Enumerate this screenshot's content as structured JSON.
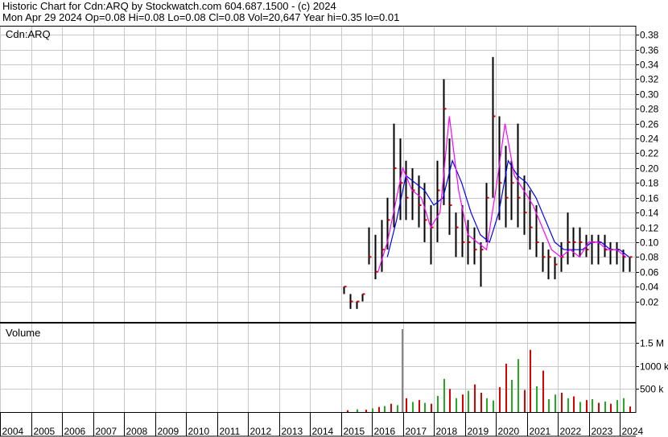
{
  "header": {
    "line1": "Historic Chart for Cdn:ARQ by Stockwatch.com 604.687.1500 - (c) 2024",
    "line2": "Mon Apr 29 2024  Op=0.08  Hi=0.08  Lo=0.08  Cl=0.08  Vol=20,647  Year hi=0.35  lo=0.01"
  },
  "panels": {
    "price_label": "Cdn:ARQ",
    "volume_label": "Volume"
  },
  "colors": {
    "background": "#ffffff",
    "grid": "#c8c8c8",
    "price_bars": "#000000",
    "moving_avg_fast": "#ff00ff",
    "moving_avg_slow": "#0000ff",
    "close_marks": "#cc0000",
    "volume_up": "#22aa22",
    "volume_down": "#dd0000",
    "volume_spike": "#888888"
  },
  "chart_data": [
    {
      "type": "line",
      "panel": "price",
      "title": "Cdn:ARQ",
      "x_ticks": [
        "2004",
        "2005",
        "2006",
        "2007",
        "2008",
        "2009",
        "2010",
        "2011",
        "2012",
        "2013",
        "2014",
        "2015",
        "2016",
        "2017",
        "2018",
        "2019",
        "2020",
        "2021",
        "2022",
        "2023",
        "2024"
      ],
      "y_ticks": [
        "0.38",
        "0.36",
        "0.34",
        "0.32",
        "0.30",
        "0.28",
        "0.26",
        "0.24",
        "0.22",
        "0.20",
        "0.18",
        "0.16",
        "0.14",
        "0.12",
        "0.10",
        "0.08",
        "0.06",
        "0.04",
        "0.02"
      ],
      "ylim": [
        0,
        0.39
      ],
      "grid": true,
      "series": [
        {
          "role": "high_low_close",
          "x": [
            2015.1,
            2015.3,
            2015.5,
            2015.7,
            2015.9,
            2016.1,
            2016.3,
            2016.5,
            2016.7,
            2016.9,
            2017.1,
            2017.3,
            2017.5,
            2017.7,
            2017.9,
            2018.1,
            2018.3,
            2018.5,
            2018.7,
            2018.9,
            2019.1,
            2019.3,
            2019.5,
            2019.7,
            2019.9,
            2020.1,
            2020.3,
            2020.5,
            2020.7,
            2020.9,
            2021.1,
            2021.3,
            2021.5,
            2021.7,
            2021.9,
            2022.1,
            2022.3,
            2022.5,
            2022.7,
            2022.9,
            2023.1,
            2023.3,
            2023.5,
            2023.7,
            2023.9,
            2024.1,
            2024.3
          ],
          "high": [
            0.04,
            0.03,
            0.02,
            0.03,
            0.12,
            0.11,
            0.13,
            0.16,
            0.26,
            0.24,
            0.21,
            0.2,
            0.19,
            0.18,
            0.15,
            0.21,
            0.32,
            0.24,
            0.14,
            0.15,
            0.13,
            0.12,
            0.1,
            0.18,
            0.35,
            0.27,
            0.23,
            0.21,
            0.26,
            0.19,
            0.17,
            0.15,
            0.1,
            0.09,
            0.08,
            0.1,
            0.14,
            0.12,
            0.12,
            0.11,
            0.11,
            0.11,
            0.11,
            0.1,
            0.1,
            0.09,
            0.08
          ],
          "low": [
            0.03,
            0.01,
            0.01,
            0.02,
            0.07,
            0.05,
            0.06,
            0.09,
            0.12,
            0.13,
            0.13,
            0.13,
            0.12,
            0.1,
            0.07,
            0.1,
            0.15,
            0.11,
            0.08,
            0.08,
            0.07,
            0.07,
            0.04,
            0.1,
            0.16,
            0.13,
            0.12,
            0.13,
            0.12,
            0.11,
            0.09,
            0.08,
            0.06,
            0.05,
            0.05,
            0.06,
            0.07,
            0.08,
            0.08,
            0.08,
            0.07,
            0.07,
            0.08,
            0.07,
            0.07,
            0.06,
            0.06
          ],
          "close": [
            0.04,
            0.02,
            0.02,
            0.03,
            0.08,
            0.06,
            0.09,
            0.13,
            0.2,
            0.18,
            0.16,
            0.17,
            0.15,
            0.13,
            0.12,
            0.17,
            0.28,
            0.15,
            0.12,
            0.1,
            0.1,
            0.09,
            0.09,
            0.16,
            0.27,
            0.18,
            0.16,
            0.18,
            0.16,
            0.14,
            0.12,
            0.1,
            0.08,
            0.08,
            0.07,
            0.08,
            0.1,
            0.1,
            0.1,
            0.09,
            0.1,
            0.1,
            0.09,
            0.09,
            0.09,
            0.08,
            0.08
          ]
        },
        {
          "role": "moving_average_fast",
          "x": [
            2016.2,
            2016.5,
            2016.8,
            2017.0,
            2017.3,
            2017.6,
            2017.9,
            2018.2,
            2018.5,
            2018.8,
            2019.1,
            2019.4,
            2019.7,
            2020.0,
            2020.3,
            2020.6,
            2020.9,
            2021.2,
            2021.5,
            2021.8,
            2022.1,
            2022.4,
            2022.7,
            2023.0,
            2023.3,
            2023.6,
            2023.9,
            2024.2
          ],
          "values": [
            0.06,
            0.1,
            0.16,
            0.2,
            0.17,
            0.16,
            0.12,
            0.14,
            0.27,
            0.17,
            0.11,
            0.1,
            0.09,
            0.17,
            0.26,
            0.19,
            0.17,
            0.15,
            0.12,
            0.09,
            0.08,
            0.09,
            0.08,
            0.1,
            0.1,
            0.09,
            0.09,
            0.08
          ]
        },
        {
          "role": "moving_average_slow",
          "x": [
            2016.5,
            2016.8,
            2017.1,
            2017.4,
            2017.7,
            2018.0,
            2018.3,
            2018.6,
            2018.9,
            2019.2,
            2019.5,
            2019.8,
            2020.1,
            2020.4,
            2020.7,
            2021.0,
            2021.3,
            2021.6,
            2021.9,
            2022.2,
            2022.5,
            2022.8,
            2023.1,
            2023.4,
            2023.7,
            2024.0,
            2024.3
          ],
          "values": [
            0.08,
            0.13,
            0.19,
            0.18,
            0.17,
            0.15,
            0.16,
            0.21,
            0.18,
            0.14,
            0.11,
            0.1,
            0.14,
            0.21,
            0.19,
            0.18,
            0.16,
            0.13,
            0.1,
            0.09,
            0.09,
            0.09,
            0.1,
            0.1,
            0.09,
            0.09,
            0.08
          ]
        }
      ]
    },
    {
      "type": "bar",
      "panel": "volume",
      "title": "Volume",
      "y_ticks": [
        "1.5 M",
        "1000 k",
        "500 k"
      ],
      "ylim": [
        0,
        1800000
      ],
      "x": [
        2015.2,
        2015.5,
        2015.8,
        2016.0,
        2016.2,
        2016.4,
        2016.6,
        2016.8,
        2016.95,
        2017.1,
        2017.3,
        2017.5,
        2017.7,
        2017.9,
        2018.1,
        2018.3,
        2018.5,
        2018.7,
        2018.9,
        2019.1,
        2019.3,
        2019.5,
        2019.7,
        2019.9,
        2020.1,
        2020.3,
        2020.5,
        2020.7,
        2020.9,
        2021.1,
        2021.3,
        2021.5,
        2021.7,
        2021.9,
        2022.1,
        2022.3,
        2022.5,
        2022.7,
        2022.9,
        2023.1,
        2023.3,
        2023.5,
        2023.7,
        2023.9,
        2024.1,
        2024.3
      ],
      "values": [
        40000,
        60000,
        50000,
        80000,
        110000,
        130000,
        180000,
        150000,
        1800000,
        300000,
        220000,
        260000,
        200000,
        180000,
        350000,
        720000,
        500000,
        300000,
        380000,
        460000,
        600000,
        420000,
        300000,
        250000,
        540000,
        1050000,
        700000,
        1150000,
        480000,
        1350000,
        560000,
        900000,
        280000,
        380000,
        420000,
        300000,
        340000,
        220000,
        260000,
        280000,
        200000,
        230000,
        180000,
        260000,
        300000,
        120000
      ],
      "colors": [
        "down",
        "up",
        "down",
        "up",
        "down",
        "up",
        "down",
        "up",
        "spike",
        "down",
        "up",
        "down",
        "up",
        "down",
        "up",
        "up",
        "down",
        "up",
        "down",
        "up",
        "down",
        "down",
        "up",
        "up",
        "down",
        "down",
        "up",
        "up",
        "down",
        "down",
        "up",
        "down",
        "up",
        "up",
        "down",
        "up",
        "down",
        "up",
        "down",
        "up",
        "down",
        "up",
        "down",
        "up",
        "up",
        "down"
      ]
    }
  ]
}
